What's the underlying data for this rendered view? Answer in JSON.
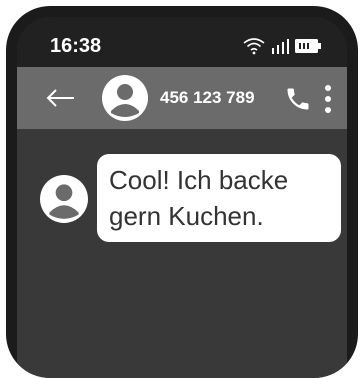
{
  "status_bar": {
    "time": "16:38",
    "icons": [
      "wifi-icon",
      "signal-icon",
      "battery-icon"
    ]
  },
  "app_bar": {
    "back_icon": "arrow-left-icon",
    "avatar_icon": "person-icon",
    "contact_number": "456 123 789",
    "call_icon": "phone-icon",
    "menu_icon": "more-vertical-icon"
  },
  "messages": [
    {
      "sender_avatar": "person-icon",
      "text": "Cool! Ich backe\ngern Kuchen."
    }
  ],
  "colors": {
    "phone_frame": "#1b1b1b",
    "status_bar": "#212121",
    "app_bar": "#6b6b6b",
    "chat_background": "#393939",
    "bubble": "#ffffff",
    "avatar_fill": "#ffffff",
    "avatar_person": "#6b6b6b"
  }
}
